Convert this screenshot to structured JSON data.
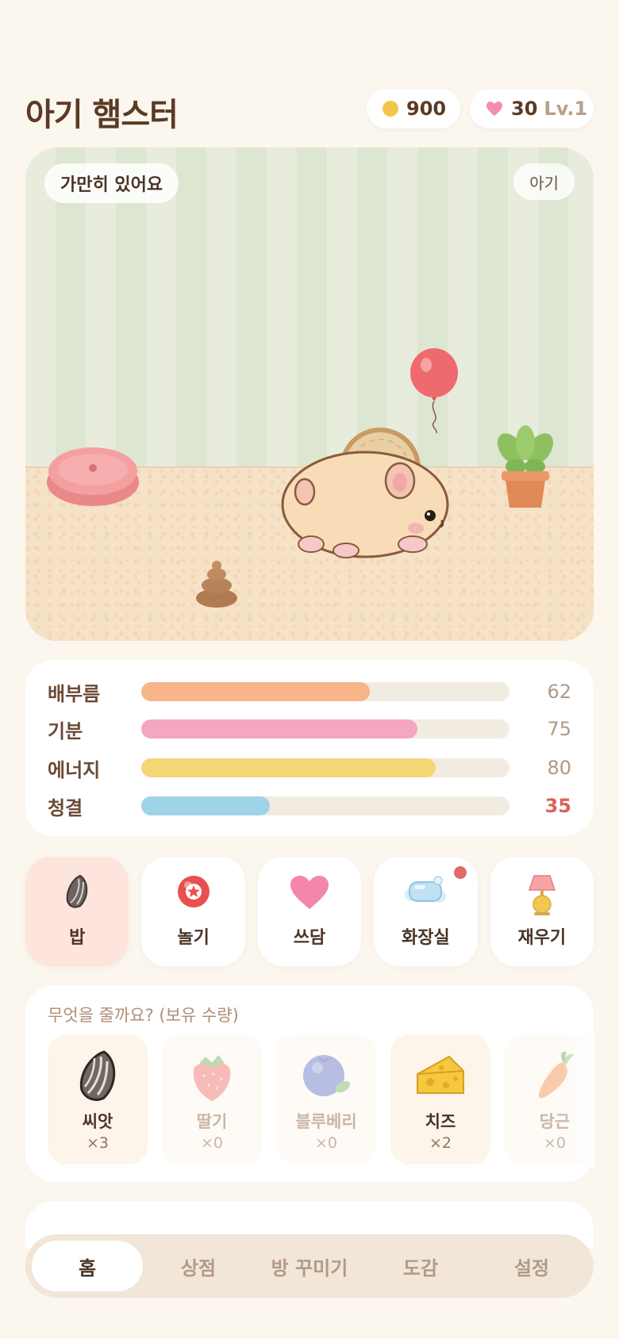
{
  "header": {
    "title": "아기 햄스터",
    "coins": "900",
    "hearts": "30",
    "level": "Lv.1"
  },
  "room": {
    "status": "가만히 있어요",
    "stage": "아기"
  },
  "stats": [
    {
      "label": "배부름",
      "value": "62",
      "percent": 62,
      "color": "#f8b58a",
      "warn": false
    },
    {
      "label": "기분",
      "value": "75",
      "percent": 75,
      "color": "#f4a6c3",
      "warn": false
    },
    {
      "label": "에너지",
      "value": "80",
      "percent": 80,
      "color": "#f5d676",
      "warn": false
    },
    {
      "label": "청결",
      "value": "35",
      "percent": 35,
      "color": "#9fd3e7",
      "warn": true
    }
  ],
  "actions": [
    {
      "label": "밥",
      "icon": "sunflower-seed-icon"
    },
    {
      "label": "놀기",
      "icon": "star-ball-icon"
    },
    {
      "label": "쓰담",
      "icon": "heart-icon"
    },
    {
      "label": "화장실",
      "icon": "soap-icon"
    },
    {
      "label": "재우기",
      "icon": "lamp-icon"
    }
  ],
  "food": {
    "prompt": "무엇을 줄까요? (보유 수량)",
    "items": [
      {
        "name": "씨앗",
        "count": "×3",
        "icon": "seed-icon"
      },
      {
        "name": "딸기",
        "count": "×0",
        "icon": "strawberry-icon"
      },
      {
        "name": "블루베리",
        "count": "×0",
        "icon": "blueberry-icon"
      },
      {
        "name": "치즈",
        "count": "×2",
        "icon": "cheese-icon"
      },
      {
        "name": "당근",
        "count": "×0",
        "icon": "carrot-icon"
      }
    ]
  },
  "tabs": [
    "홈",
    "상점",
    "방 꾸미기",
    "도감",
    "설정"
  ],
  "colors": {
    "background": "#fbf6ee",
    "accent": "#fde4dc",
    "warning": "#e0605a"
  }
}
